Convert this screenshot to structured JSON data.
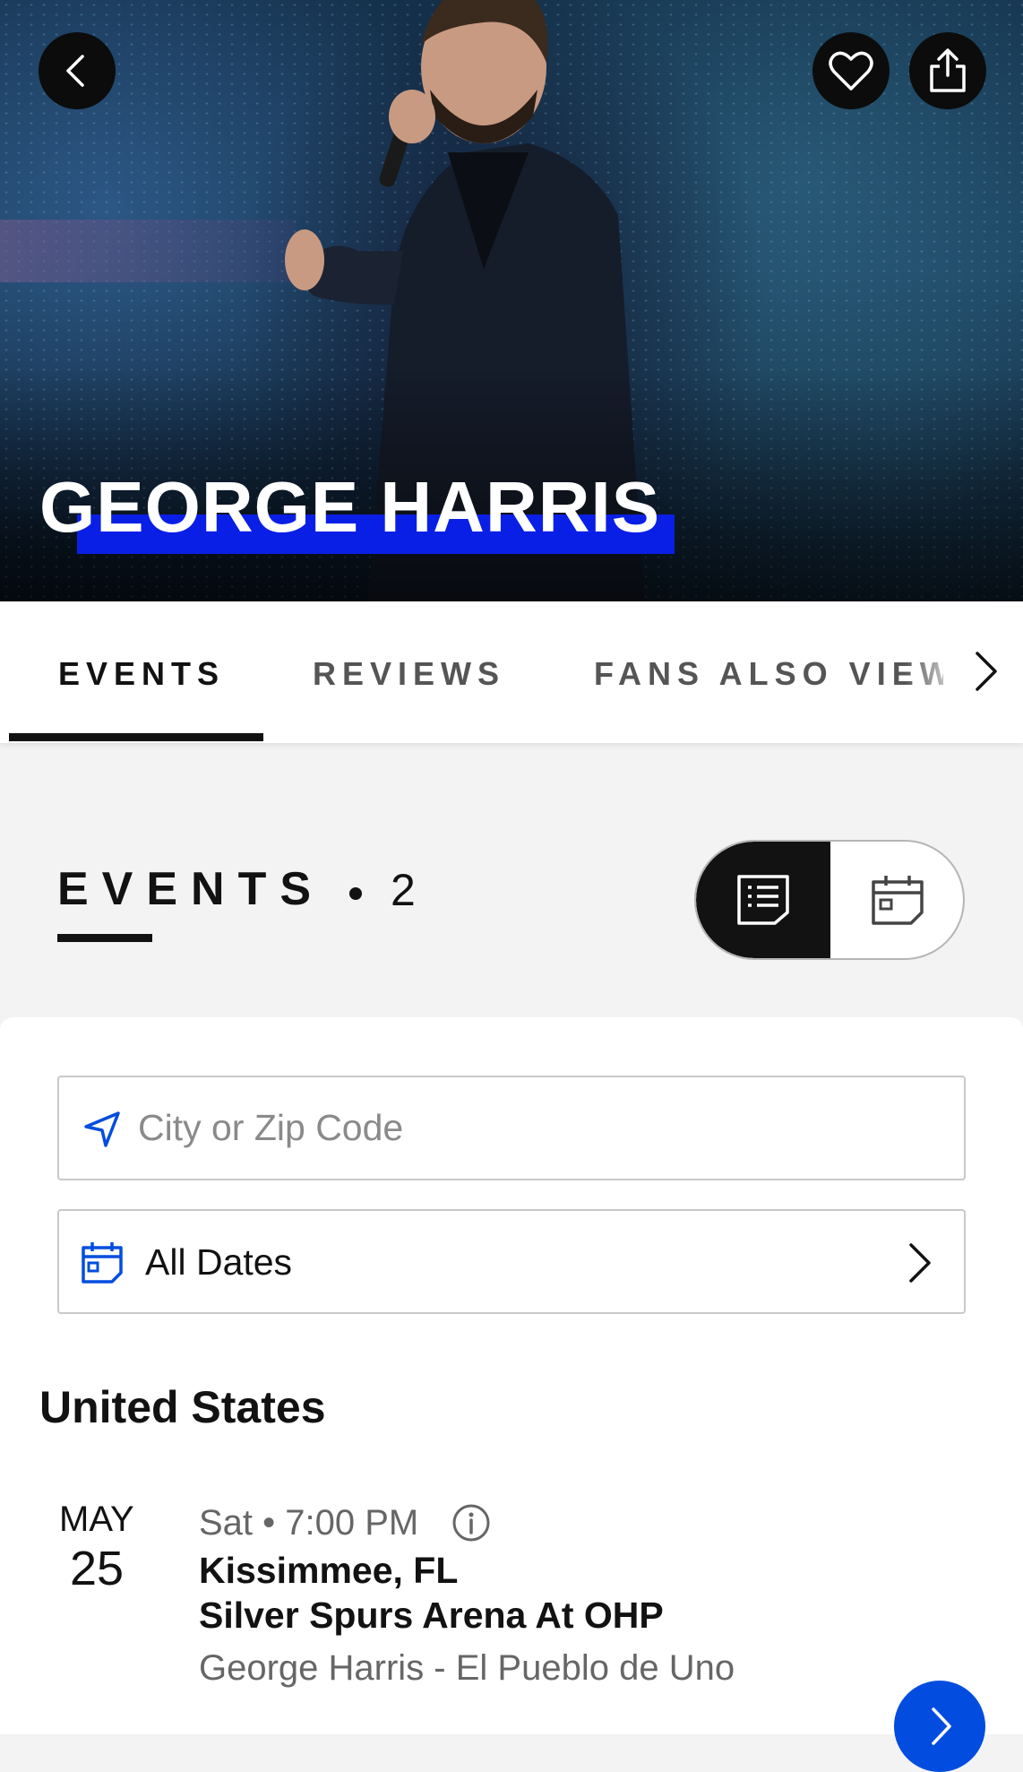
{
  "hero": {
    "title": "GEORGE HARRIS"
  },
  "tabs": [
    {
      "label": "EVENTS",
      "active": true
    },
    {
      "label": "REVIEWS",
      "active": false
    },
    {
      "label": "FANS ALSO VIEWED",
      "active": false
    }
  ],
  "events_section": {
    "heading": "EVENTS",
    "count": "2"
  },
  "filters": {
    "location_placeholder": "City or Zip Code",
    "dates_label": "All Dates"
  },
  "region": "United States",
  "events": [
    {
      "month": "MAY",
      "day": "25",
      "time": "Sat • 7:00 PM",
      "city": "Kissimmee, FL",
      "venue": "Silver Spurs Arena At OHP",
      "name": "George Harris - El Pueblo de Uno"
    }
  ],
  "colors": {
    "accent_blue": "#024ddf",
    "title_underline": "#0a1fe6",
    "dark": "#121212"
  }
}
